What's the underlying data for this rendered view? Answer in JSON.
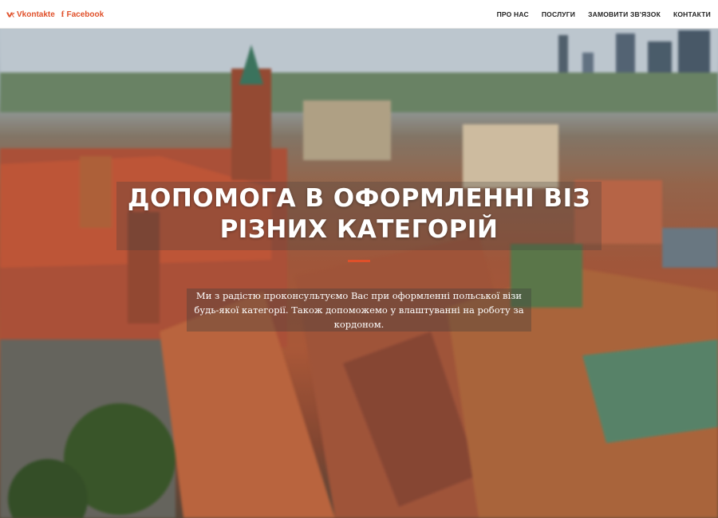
{
  "social": {
    "vk_label": "Vkontakte",
    "fb_label": "Facebook",
    "icon_color": "#e0502a"
  },
  "nav": {
    "items": [
      "ПРО НАС",
      "ПОСЛУГИ",
      "ЗАМОВИТИ ЗВ'ЯЗОК",
      "КОНТАКТИ"
    ]
  },
  "hero": {
    "title": "ДОПОМОГА В ОФОРМЛЕННІ ВІЗ\nРІЗНИХ КАТЕГОРІЙ",
    "lead": "Ми з радістю проконсультуємо Вас при оформленні польської візи будь-якої категорії. Також допоможемо у влаштуванні на роботу за кордоном.",
    "accent_color": "#e0502a"
  }
}
